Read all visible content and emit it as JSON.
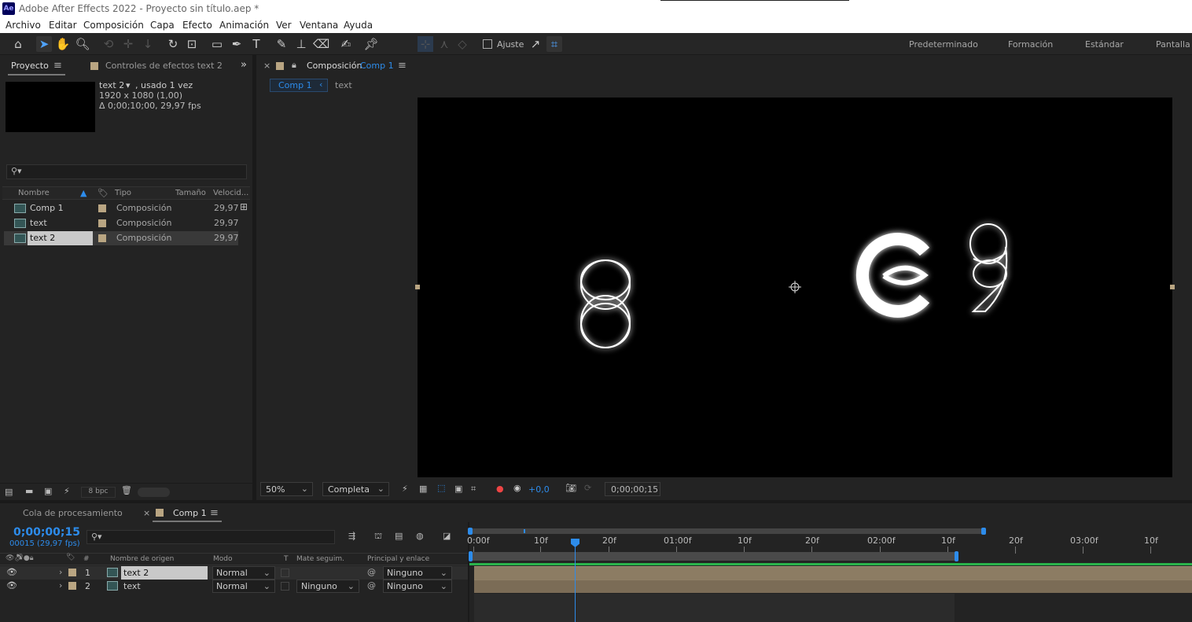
{
  "window": {
    "logo": "Ae",
    "title": "Adobe After Effects 2022 - Proyecto sin título.aep *"
  },
  "menu": [
    "Archivo",
    "Editar",
    "Composición",
    "Capa",
    "Efecto",
    "Animación",
    "Ver",
    "Ventana",
    "Ayuda"
  ],
  "toolbar": {
    "snap_label": "Ajuste",
    "workspaces": [
      "Predeterminado",
      "Formación",
      "Estándar",
      "Pantalla"
    ]
  },
  "project_panel": {
    "tab_project": "Proyecto",
    "tab_effects": "Controles de efectos text 2",
    "selected_name": "text 2",
    "selected_used": ", usado 1 vez",
    "selected_dims": "1920 x 1080 (1,00)",
    "selected_duration": "Δ 0;00;10;00, 29,97 fps",
    "search_placeholder": "",
    "columns": {
      "name": "Nombre",
      "type": "Tipo",
      "size": "Tamaño",
      "speed": "Velocid..."
    },
    "items": [
      {
        "name": "Comp 1",
        "type": "Composición",
        "fps": "29,97"
      },
      {
        "name": "text",
        "type": "Composición",
        "fps": "29,97"
      },
      {
        "name": "text 2",
        "type": "Composición",
        "fps": "29,97"
      }
    ],
    "bpc": "8 bpc"
  },
  "comp_panel": {
    "tab_prefix": "Composición",
    "tab_comp": "Comp 1",
    "breadcrumbs": [
      "Comp 1",
      "text"
    ],
    "zoom": "50%",
    "resolution": "Completa",
    "exposure": "+0,0",
    "timecode": "0;00;00;15",
    "glyphs": {
      "left": "8",
      "center": "€",
      "right": "9"
    }
  },
  "timeline": {
    "tab_queue": "Cola de procesamiento",
    "tab_comp": "Comp 1",
    "timecode": "0;00;00;15",
    "frames": "00015 (29,97 fps)",
    "headers": {
      "num": "#",
      "source": "Nombre de origen",
      "mode": "Modo",
      "t": "T",
      "matte": "Mate seguim.",
      "parent": "Principal y enlace"
    },
    "layers": [
      {
        "num": "1",
        "name": "text 2",
        "mode": "Normal",
        "matte": "",
        "parent": "Ninguno"
      },
      {
        "num": "2",
        "name": "text",
        "mode": "Normal",
        "matte": "Ninguno",
        "parent": "Ninguno"
      }
    ],
    "ruler": [
      "0:00f",
      "10f",
      "20f",
      "01:00f",
      "10f",
      "20f",
      "02:00f",
      "10f",
      "20f",
      "03:00f",
      "10f"
    ]
  },
  "colors": {
    "accent": "#2d8ceb",
    "label": "#b9a582",
    "green_bar": "#2bb34b"
  }
}
